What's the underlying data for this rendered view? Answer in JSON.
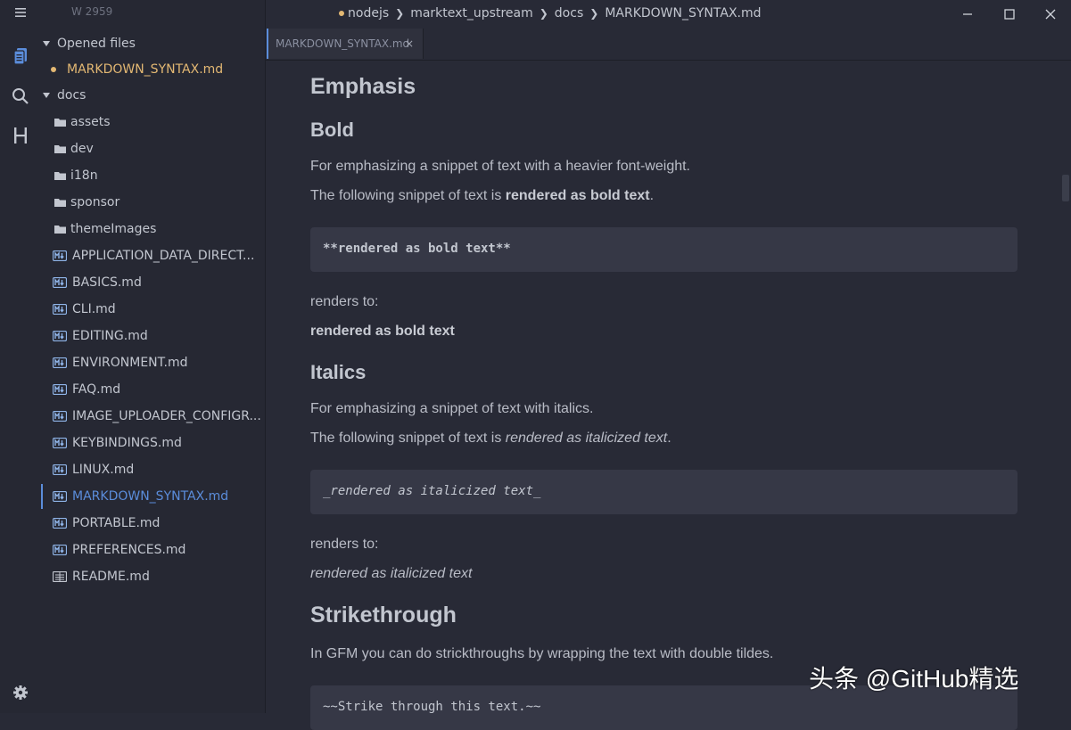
{
  "sidebar": {
    "word_count": "W 2959",
    "opened_section": "Opened files",
    "opened_file": "MARKDOWN_SYNTAX.md",
    "folder": "docs",
    "subfolders": [
      "assets",
      "dev",
      "i18n",
      "sponsor",
      "themeImages"
    ],
    "files": [
      "APPLICATION_DATA_DIRECT...",
      "BASICS.md",
      "CLI.md",
      "EDITING.md",
      "ENVIRONMENT.md",
      "FAQ.md",
      "IMAGE_UPLOADER_CONFIGR...",
      "KEYBINDINGS.md",
      "LINUX.md",
      "MARKDOWN_SYNTAX.md",
      "PORTABLE.md",
      "PREFERENCES.md",
      "README.md"
    ],
    "active_file": "MARKDOWN_SYNTAX.md"
  },
  "rail_icons": [
    "menu-icon",
    "files-icon",
    "search-icon",
    "heading-icon",
    "settings-icon"
  ],
  "titlebar": {
    "breadcrumbs": [
      "nodejs",
      "marktext_upstream",
      "docs",
      "MARKDOWN_SYNTAX.md"
    ]
  },
  "tab": {
    "label": "MARKDOWN_SYNTAX.md",
    "close": "×"
  },
  "doc": {
    "h_emphasis": "Emphasis",
    "h_bold": "Bold",
    "bold_p1": "For emphasizing a snippet of text with a heavier font-weight.",
    "bold_p2_pre": "The following snippet of text is ",
    "bold_p2_strong": "rendered as bold text",
    "bold_p2_post": ".",
    "bold_code": "**rendered as bold text**",
    "renders_to": "renders to:",
    "bold_result": "rendered as bold text",
    "h_italics": "Italics",
    "italic_p1": "For emphasizing a snippet of text with italics.",
    "italic_p2_pre": "The following snippet of text is ",
    "italic_p2_em": "rendered as italicized text",
    "italic_p2_post": ".",
    "italic_code": "_rendered as italicized text_",
    "italic_result": "rendered as italicized text",
    "h_strike": "Strikethrough",
    "strike_p1": "In GFM you can do strickthroughs by wrapping the text with double tildes.",
    "strike_code": "~~Strike through this text.~~"
  },
  "watermark": "头条 @GitHub精选",
  "colors": {
    "accent": "#5b8ddb",
    "modified_dot": "#e3b873",
    "background": "#282a36"
  }
}
